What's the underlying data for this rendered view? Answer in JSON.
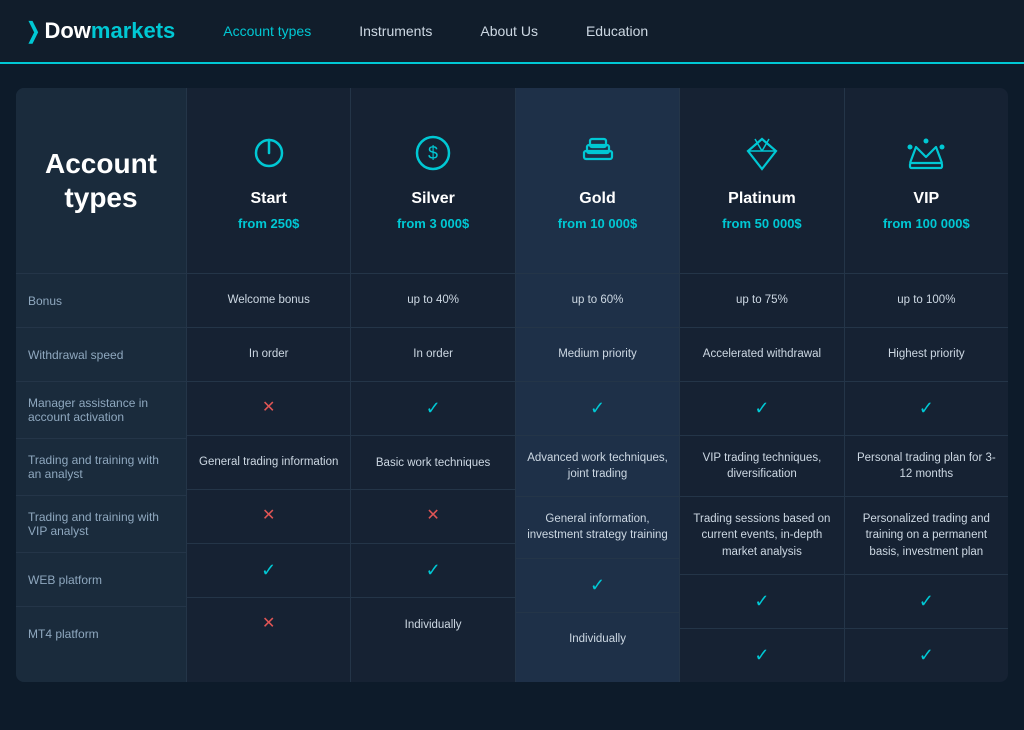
{
  "navbar": {
    "logo": "Dowmarkets",
    "logo_dow": "Dow",
    "logo_markets": "markets",
    "nav_items": [
      {
        "label": "Account types",
        "active": true
      },
      {
        "label": "Instruments"
      },
      {
        "label": "About Us"
      },
      {
        "label": "Education"
      }
    ]
  },
  "left": {
    "title": "Account types",
    "row_labels": [
      "Bonus",
      "Withdrawal speed",
      "Manager assistance in account activation",
      "Trading and training with an analyst",
      "Trading and training with VIP analyst",
      "WEB platform",
      "MT4 platform"
    ]
  },
  "columns": [
    {
      "id": "start",
      "name": "Start",
      "price": "from 250$",
      "icon": "power",
      "cells": [
        {
          "type": "text",
          "value": "Welcome bonus"
        },
        {
          "type": "text",
          "value": "In order"
        },
        {
          "type": "cross"
        },
        {
          "type": "text",
          "value": "General trading information"
        },
        {
          "type": "cross"
        },
        {
          "type": "check"
        },
        {
          "type": "cross"
        }
      ]
    },
    {
      "id": "silver",
      "name": "Silver",
      "price": "from 3 000$",
      "icon": "dollar",
      "cells": [
        {
          "type": "text",
          "value": "up to 40%"
        },
        {
          "type": "text",
          "value": "In order"
        },
        {
          "type": "check"
        },
        {
          "type": "text",
          "value": "Basic work techniques"
        },
        {
          "type": "cross"
        },
        {
          "type": "check"
        },
        {
          "type": "text",
          "value": "Individually"
        }
      ]
    },
    {
      "id": "gold",
      "name": "Gold",
      "price": "from 10 000$",
      "icon": "bars",
      "cells": [
        {
          "type": "text",
          "value": "up to 60%"
        },
        {
          "type": "text",
          "value": "Medium priority"
        },
        {
          "type": "check"
        },
        {
          "type": "text",
          "value": "Advanced work techniques, joint trading"
        },
        {
          "type": "text",
          "value": "General information, investment strategy training"
        },
        {
          "type": "check"
        },
        {
          "type": "text",
          "value": "Individually"
        }
      ]
    },
    {
      "id": "platinum",
      "name": "Platinum",
      "price": "from 50 000$",
      "icon": "diamond",
      "cells": [
        {
          "type": "text",
          "value": "up to 75%"
        },
        {
          "type": "text",
          "value": "Accelerated withdrawal"
        },
        {
          "type": "check"
        },
        {
          "type": "text",
          "value": "VIP trading techniques, diversification"
        },
        {
          "type": "text",
          "value": "Trading sessions based on current events, in-depth market analysis"
        },
        {
          "type": "check"
        },
        {
          "type": "check"
        }
      ]
    },
    {
      "id": "vip",
      "name": "VIP",
      "price": "from 100 000$",
      "icon": "crown",
      "cells": [
        {
          "type": "text",
          "value": "up to 100%"
        },
        {
          "type": "text",
          "value": "Highest priority"
        },
        {
          "type": "check"
        },
        {
          "type": "text",
          "value": "Personal trading plan for 3-12 months"
        },
        {
          "type": "text",
          "value": "Personalized trading and training on a permanent basis, investment plan"
        },
        {
          "type": "check"
        },
        {
          "type": "check"
        }
      ]
    }
  ]
}
